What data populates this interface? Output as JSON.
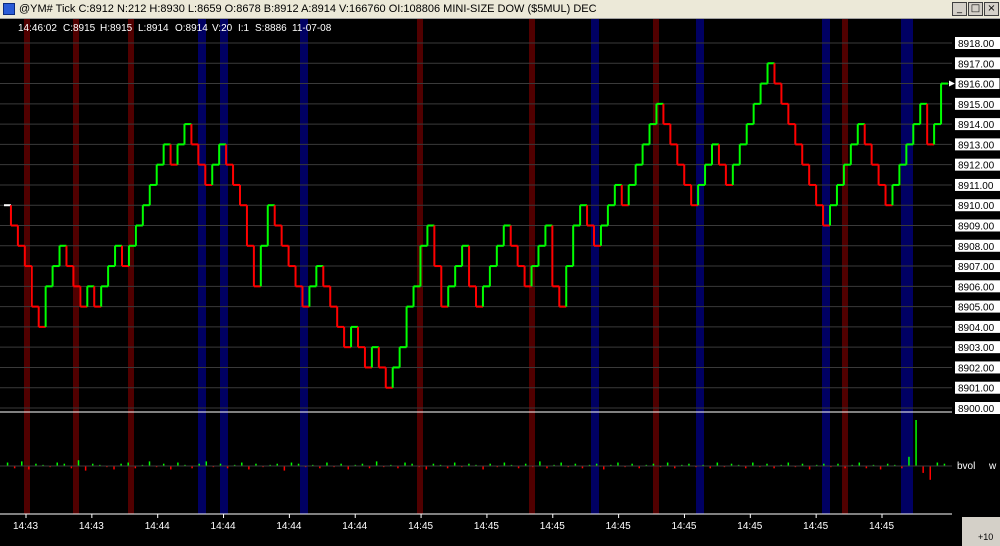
{
  "window": {
    "title": "@YM# Tick C:8912 N:212 H:8930 L:8659 O:8678 B:8912 A:8914 V:166760 OI:108806 MINI-SIZE DOW ($5MUL) DEC",
    "minimize_label": "_",
    "maximize_label": "□",
    "close_label": "×"
  },
  "info_bar": {
    "time": "14:46:02",
    "close": "C:8915",
    "high": "H:8915",
    "low": "L:8914",
    "open": "O:8914",
    "volume": "V:20",
    "interval": "I:1",
    "settle": "S:8886",
    "date": "11-07-08"
  },
  "indicator": {
    "name": "bvol",
    "cut_label": "w"
  },
  "footer": {
    "zoom_label": "+10"
  },
  "colors": {
    "background": "#000000",
    "up": "#00ff00",
    "down": "#ff0000",
    "flat": "#ffffff",
    "band_red": "#5a0000",
    "band_blue": "#00006e",
    "grid": "#3a3a3a",
    "price_label_bg": "#ffffff"
  },
  "chart_data": {
    "type": "line",
    "title": "@YM# Tick MINI-SIZE DOW ($5MUL) DEC",
    "xlabel": "",
    "ylabel": "",
    "ylim": [
      8900,
      8918
    ],
    "y_ticks": [
      "8918.00",
      "8917.00",
      "8916.00",
      "8915.00",
      "8914.00",
      "8913.00",
      "8912.00",
      "8911.00",
      "8910.00",
      "8909.00",
      "8908.00",
      "8907.00",
      "8906.00",
      "8905.00",
      "8904.00",
      "8903.00",
      "8902.00",
      "8901.00",
      "8900.00"
    ],
    "x_tick_labels": [
      "14:43",
      "14:43",
      "14:44",
      "14:44",
      "14:44",
      "14:44",
      "14:45",
      "14:45",
      "14:45",
      "14:45",
      "14:45",
      "14:45",
      "14:45",
      "14:45"
    ],
    "last_price": "8916.00",
    "series": [
      {
        "name": "@YM#",
        "values": [
          8910,
          8909,
          8908,
          8907,
          8905,
          8904,
          8906,
          8907,
          8908,
          8907,
          8906,
          8905,
          8906,
          8905,
          8906,
          8907,
          8908,
          8907,
          8908,
          8909,
          8910,
          8911,
          8912,
          8913,
          8912,
          8913,
          8914,
          8913,
          8912,
          8911,
          8912,
          8913,
          8912,
          8911,
          8910,
          8908,
          8906,
          8908,
          8910,
          8909,
          8908,
          8907,
          8906,
          8905,
          8906,
          8907,
          8906,
          8905,
          8904,
          8903,
          8904,
          8903,
          8902,
          8903,
          8902,
          8901,
          8902,
          8903,
          8905,
          8906,
          8908,
          8909,
          8907,
          8905,
          8906,
          8907,
          8908,
          8906,
          8905,
          8906,
          8907,
          8908,
          8909,
          8908,
          8907,
          8906,
          8907,
          8908,
          8909,
          8906,
          8905,
          8907,
          8909,
          8910,
          8909,
          8908,
          8909,
          8910,
          8911,
          8910,
          8911,
          8912,
          8913,
          8914,
          8915,
          8914,
          8913,
          8912,
          8911,
          8910,
          8911,
          8912,
          8913,
          8912,
          8911,
          8912,
          8913,
          8914,
          8915,
          8916,
          8917,
          8916,
          8915,
          8914,
          8913,
          8912,
          8911,
          8910,
          8909,
          8910,
          8911,
          8912,
          8913,
          8914,
          8913,
          8912,
          8911,
          8910,
          8911,
          8912,
          8913,
          8914,
          8915,
          8913,
          8914,
          8916
        ]
      }
    ],
    "band_type_cycle": [
      "red",
      "red",
      "red",
      "blue",
      "blue",
      "blue",
      "red",
      "red",
      "blue",
      "red",
      "blue",
      "blue",
      "red",
      "blue",
      "red",
      "red",
      "blue",
      "blue",
      "red",
      "blue"
    ],
    "indicator_bvol": [
      3,
      -2,
      4,
      -3,
      2,
      1,
      -1,
      3,
      2,
      -2,
      5,
      -4,
      2,
      1,
      -1,
      -3,
      2,
      3,
      -2,
      1,
      4,
      -1,
      2,
      -3,
      3,
      1,
      -2,
      2,
      4,
      -1,
      2,
      -2,
      1,
      3,
      -3,
      2,
      -1,
      1,
      2,
      -4,
      3,
      2,
      -1,
      1,
      -2,
      3,
      -1,
      2,
      -3,
      1,
      2,
      -2,
      4,
      -1,
      1,
      -2,
      3,
      2,
      -1,
      -3,
      2,
      1,
      -2,
      3,
      -1,
      2,
      1,
      -3,
      2,
      -1,
      3,
      1,
      -2,
      2,
      -1,
      4,
      -2,
      1,
      3,
      -1,
      2,
      -2,
      1,
      2,
      -3,
      1,
      3,
      -1,
      2,
      -2,
      1,
      2,
      -1,
      3,
      -2,
      1,
      2,
      -1,
      1,
      -2,
      3,
      -1,
      2,
      1,
      -2,
      3,
      -1,
      2,
      -2,
      1,
      3,
      -1,
      2,
      -3,
      1,
      2,
      -1,
      2,
      -2,
      1,
      3,
      -2,
      1,
      -3,
      2,
      1,
      -2,
      8,
      40,
      -6,
      -12,
      3,
      2
    ]
  }
}
